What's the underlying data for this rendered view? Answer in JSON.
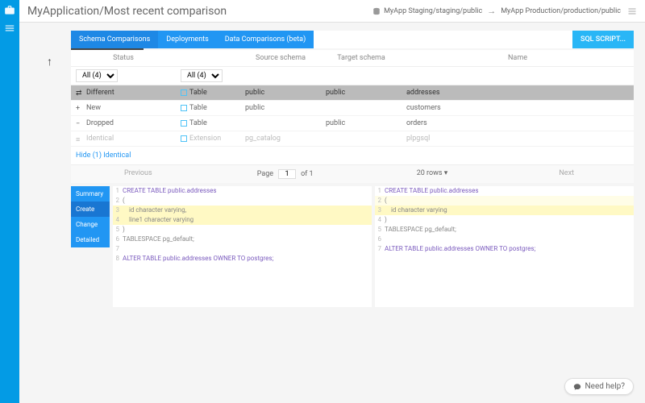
{
  "header": {
    "title": "MyApplication/Most recent comparison",
    "crumb_left": "MyApp Staging/staging/public",
    "crumb_right": "MyApp Production/production/public"
  },
  "tabs": {
    "items": [
      "Schema Comparisons",
      "Deployments",
      "Data Comparisons (beta)"
    ],
    "active": 0
  },
  "sql_button": "SQL SCRIPT...",
  "table": {
    "headers": [
      "Status",
      "",
      "Source schema",
      "Target schema",
      "Name"
    ],
    "filter_status": "All (4)",
    "filter_type": "All (4)",
    "rows": [
      {
        "status": "Different",
        "type": "Table",
        "src": "public",
        "tgt": "public",
        "name": "addresses",
        "sel": true,
        "icon": "diff"
      },
      {
        "status": "New",
        "type": "Table",
        "src": "public",
        "tgt": "",
        "name": "customers",
        "sel": false,
        "icon": "new"
      },
      {
        "status": "Dropped",
        "type": "Table",
        "src": "",
        "tgt": "public",
        "name": "orders",
        "sel": false,
        "icon": "drop"
      },
      {
        "status": "Identical",
        "type": "Extension",
        "src": "pg_catalog",
        "tgt": "",
        "name": "plpgsql",
        "sel": false,
        "icon": "eq",
        "faded": true
      }
    ],
    "hide_link": "Hide (1) Identical"
  },
  "pager": {
    "prev": "Previous",
    "page_label": "Page",
    "page": "1",
    "of": "of 1",
    "rows": "20 rows",
    "next": "Next"
  },
  "diff_tabs": [
    "Summary",
    "Create",
    "Change",
    "Detailed"
  ],
  "diff_active": 1,
  "code_left": [
    {
      "n": 1,
      "t": "CREATE TABLE public.addresses",
      "kw": true
    },
    {
      "n": 2,
      "t": "("
    },
    {
      "n": 3,
      "t": "    id character varying,",
      "hl": true
    },
    {
      "n": 4,
      "t": "    line1 character varying",
      "hl": true
    },
    {
      "n": 5,
      "t": ")"
    },
    {
      "n": 6,
      "t": "TABLESPACE pg_default;"
    },
    {
      "n": 7,
      "t": ""
    },
    {
      "n": 8,
      "t": "ALTER TABLE public.addresses OWNER TO postgres;",
      "kw": true
    }
  ],
  "code_right": [
    {
      "n": 1,
      "t": "CREATE TABLE public.addresses",
      "kw": true
    },
    {
      "n": 2,
      "t": "(",
      "hl2": true
    },
    {
      "n": 3,
      "t": "    id character varying",
      "hl": true
    },
    {
      "n": 4,
      "t": ")"
    },
    {
      "n": 5,
      "t": "TABLESPACE pg_default;"
    },
    {
      "n": 6,
      "t": ""
    },
    {
      "n": 7,
      "t": "ALTER TABLE public.addresses OWNER TO postgres;",
      "kw": true
    }
  ],
  "help": "Need help?"
}
